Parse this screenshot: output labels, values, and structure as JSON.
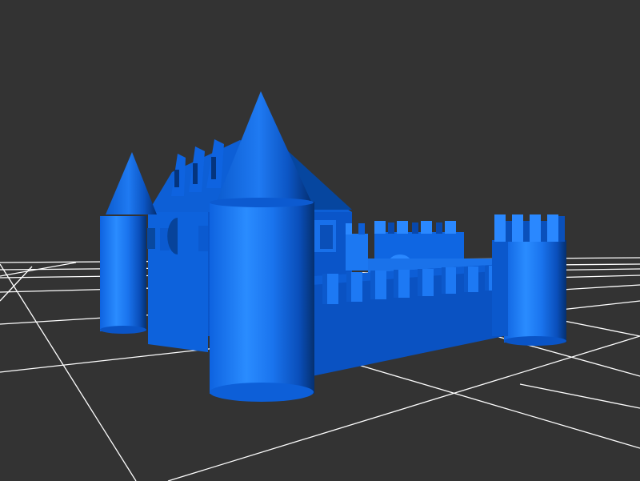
{
  "viewer": {
    "background": "#333333",
    "grid_color": "#ffffff"
  },
  "model": {
    "subject": "castle",
    "color": "#1f77ff",
    "shade_light": "#2a86ff",
    "shade_mid": "#0a5ed8",
    "shade_dark": "#06429e",
    "shade_darkest": "#032a66"
  }
}
